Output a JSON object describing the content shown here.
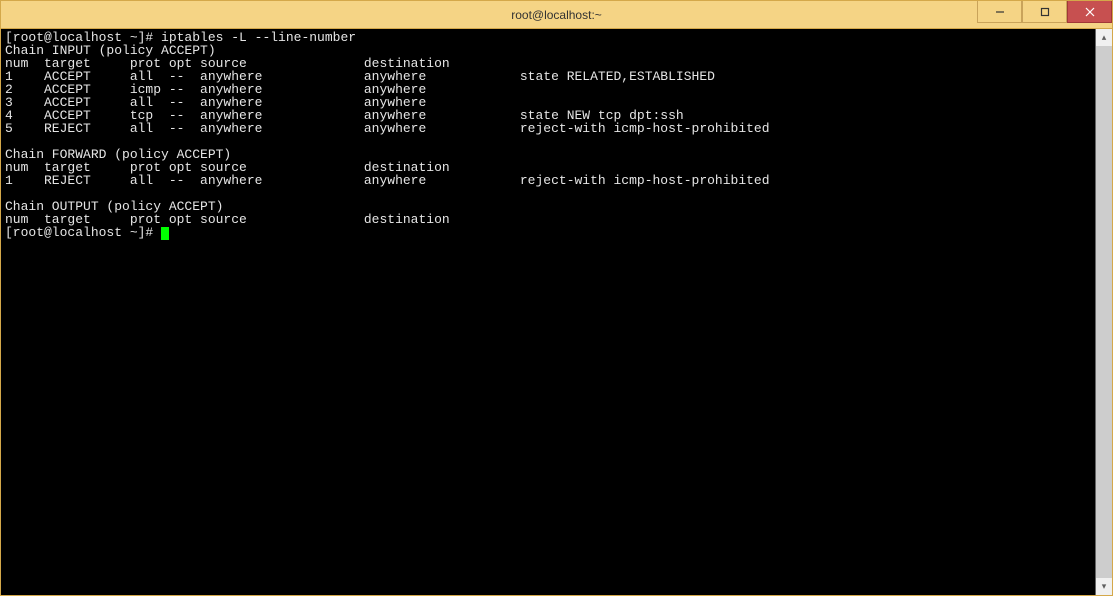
{
  "window": {
    "title": "root@localhost:~"
  },
  "prompt1": "[root@localhost ~]# ",
  "command": "iptables -L --line-number",
  "chain_input_header": "Chain INPUT (policy ACCEPT)",
  "cols_header": "num  target     prot opt source               destination         ",
  "input_rows": [
    "1    ACCEPT     all  --  anywhere             anywhere            state RELATED,ESTABLISHED ",
    "2    ACCEPT     icmp --  anywhere             anywhere            ",
    "3    ACCEPT     all  --  anywhere             anywhere            ",
    "4    ACCEPT     tcp  --  anywhere             anywhere            state NEW tcp dpt:ssh ",
    "5    REJECT     all  --  anywhere             anywhere            reject-with icmp-host-prohibited "
  ],
  "chain_forward_header": "Chain FORWARD (policy ACCEPT)",
  "forward_rows": [
    "1    REJECT     all  --  anywhere             anywhere            reject-with icmp-host-prohibited "
  ],
  "chain_output_header": "Chain OUTPUT (policy ACCEPT)",
  "output_rows": [],
  "prompt2": "[root@localhost ~]# "
}
